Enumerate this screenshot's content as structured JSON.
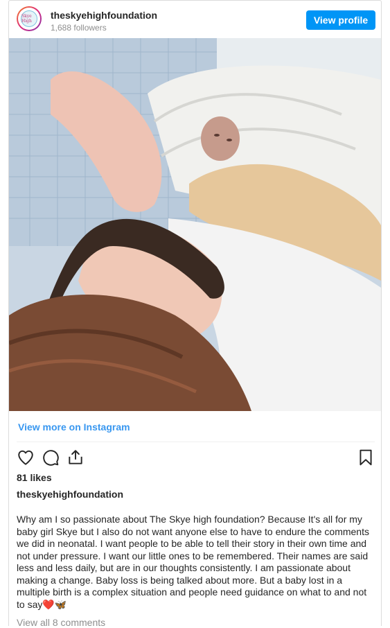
{
  "header": {
    "username": "theskyehighfoundation",
    "followers": "1,688 followers",
    "view_profile_label": "View profile",
    "avatar_text": "Skye High"
  },
  "media": {
    "view_more_label": "View more on Instagram"
  },
  "actions": {
    "icons": [
      "heart-icon",
      "comment-icon",
      "share-icon",
      "bookmark-icon"
    ]
  },
  "likes": "81 likes",
  "caption": {
    "username": "theskyehighfoundation",
    "text": "Why am I so passionate about The Skye high foundation? Because It's all for my baby girl Skye but I also do not want anyone else to have to endure the comments we did in neonatal. I want people to be able to tell their story in their own time and not under pressure. I want our little ones to be remembered. Their names are said less and less daily, but are in our thoughts consistently. I am passionate about making a change. Baby loss is being talked about more. But a baby lost in a multiple birth is a complex situation and people need guidance on what to and not to say",
    "emoji": "❤️🦋"
  },
  "comments_link": "View all 8 comments",
  "colors": {
    "accent": "#0095f6",
    "link": "#3897f0",
    "muted": "#8e8e8e"
  }
}
